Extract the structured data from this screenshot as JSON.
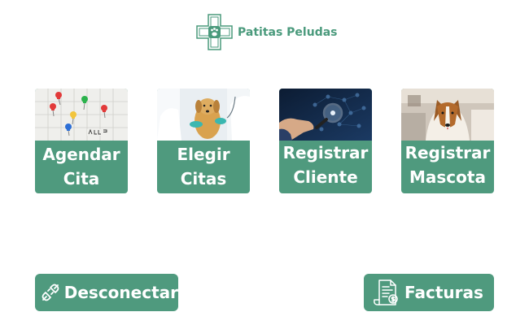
{
  "brand": {
    "name": "Patitas Peludas",
    "icon": "paw-cross-icon",
    "color": "#4a9a7c"
  },
  "cards": [
    {
      "label": "Agendar\nCita",
      "image": "calendar-pins-photo"
    },
    {
      "label": "Elegir\nCitas",
      "image": "vet-dog-photo"
    },
    {
      "label": "Registrar\nCliente",
      "image": "magnifier-network-photo"
    },
    {
      "label": "Registrar\nMascota",
      "image": "collie-dog-photo"
    }
  ],
  "actions": {
    "logout": {
      "label": "Desconectar",
      "icon": "plug-disconnect-icon"
    },
    "invoices": {
      "label": "Facturas",
      "icon": "invoice-document-icon"
    }
  },
  "colors": {
    "accent": "#4f9a7e",
    "text_on_accent": "#ffffff"
  }
}
